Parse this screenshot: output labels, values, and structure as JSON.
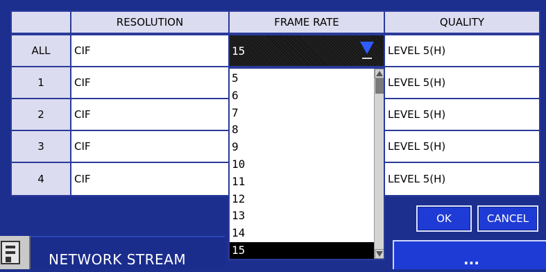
{
  "headers": {
    "resolution": "RESOLUTION",
    "frame_rate": "FRAME RATE",
    "quality": "QUALITY"
  },
  "rows": [
    {
      "label": "ALL",
      "resolution": "CIF",
      "quality": "LEVEL 5(H)"
    },
    {
      "label": "1",
      "resolution": "CIF",
      "quality": "LEVEL 5(H)"
    },
    {
      "label": "2",
      "resolution": "CIF",
      "quality": "LEVEL 5(H)"
    },
    {
      "label": "3",
      "resolution": "CIF",
      "quality": "LEVEL 5(H)"
    },
    {
      "label": "4",
      "resolution": "CIF",
      "quality": "LEVEL 5(H)"
    }
  ],
  "frame_rate_dropdown": {
    "selected": "15",
    "options": [
      "5",
      "6",
      "7",
      "8",
      "9",
      "10",
      "11",
      "12",
      "13",
      "14",
      "15"
    ]
  },
  "buttons": {
    "ok": "OK",
    "cancel": "CANCEL"
  },
  "bottom": {
    "network_stream_label": "NETWORK STREAM",
    "more_label": "..."
  },
  "icons": {
    "dropdown_arrow": "triangle-down-icon",
    "scroll_up": "triangle-up-icon",
    "scroll_down": "triangle-down-icon",
    "menu_icon": "network-icon"
  },
  "colors": {
    "background": "#1d2f8e",
    "header_bg": "#dcdcf0",
    "button": "#1f3bd6",
    "dropdown_arrow": "#2f5bff"
  }
}
